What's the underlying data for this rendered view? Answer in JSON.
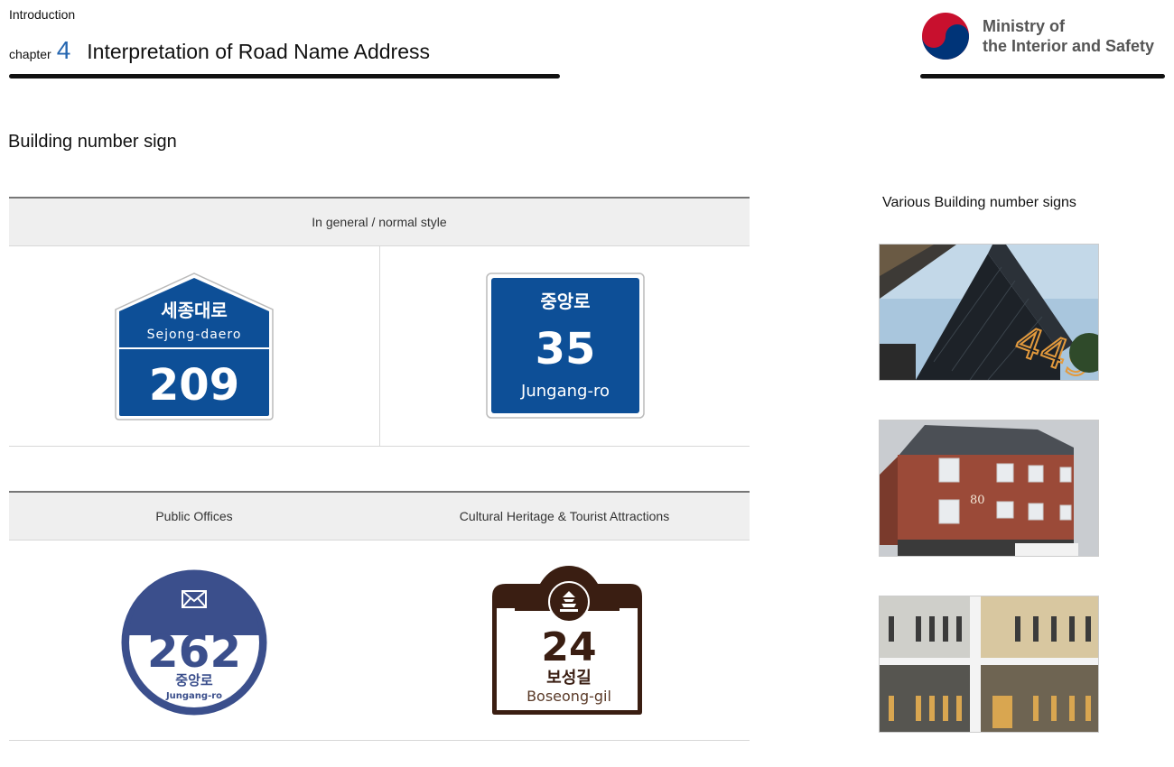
{
  "header": {
    "intro": "Introduction",
    "chapter_word": "chapter",
    "chapter_number": "4",
    "chapter_title": "Interpretation of Road Name Address",
    "ministry_line1": "Ministry of",
    "ministry_line2": "the Interior and Safety"
  },
  "section_title": "Building number sign",
  "table_general": {
    "header": "In general / normal style",
    "sign_house": {
      "road_kr": "세종대로",
      "road_en": "Sejong-daero",
      "number": "209"
    },
    "sign_square": {
      "road_kr": "중앙로",
      "number": "35",
      "road_en": "Jungang-ro"
    }
  },
  "table_special": {
    "header_left": "Public Offices",
    "header_right": "Cultural Heritage & Tourist Attractions",
    "sign_public": {
      "number": "262",
      "road_kr": "중앙로",
      "road_en": "Jungang-ro"
    },
    "sign_heritage": {
      "number": "24",
      "road_kr": "보성길",
      "road_en": "Boseong-gil"
    }
  },
  "sidebar": {
    "title": "Various Building number signs",
    "photo2_number": "80"
  },
  "colors": {
    "sign_blue": "#0d4f97",
    "public_blue": "#3b4f8c",
    "heritage_brown": "#3a1e12",
    "chapter_blue": "#2566b0"
  }
}
